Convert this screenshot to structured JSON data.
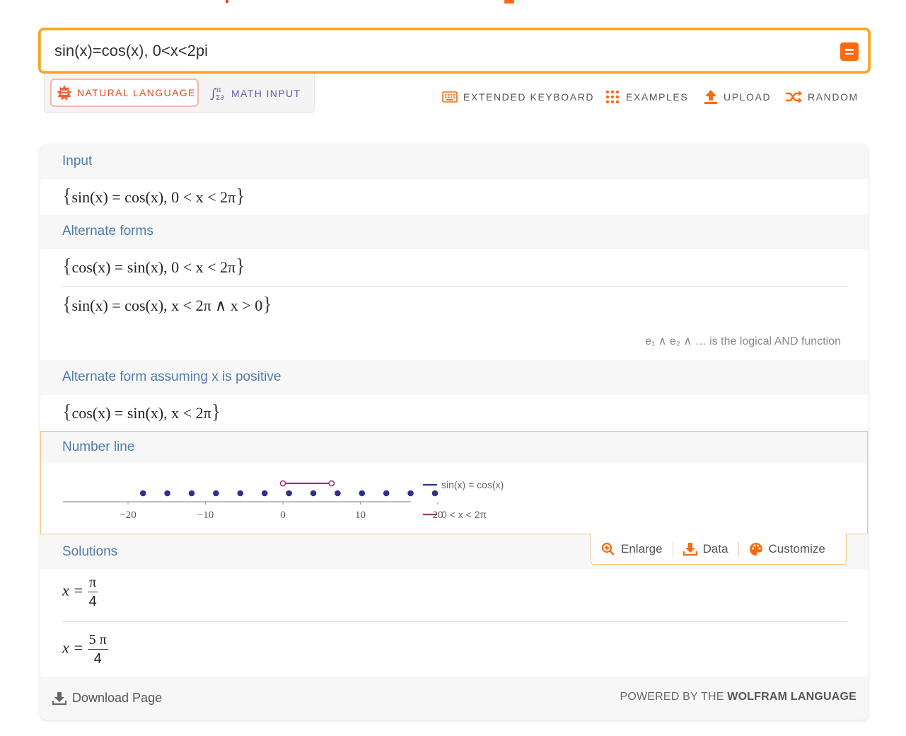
{
  "search": {
    "value": "sin(x)=cos(x), 0<x<2pi"
  },
  "modes": {
    "natural": "NATURAL LANGUAGE",
    "math": "MATH INPUT"
  },
  "toolbar": {
    "keyboard": "EXTENDED KEYBOARD",
    "examples": "EXAMPLES",
    "upload": "UPLOAD",
    "random": "RANDOM"
  },
  "pods": {
    "input": {
      "title": "Input",
      "expr": "sin(x) = cos(x), 0 < x < 2π"
    },
    "alternate_forms": {
      "title": "Alternate forms",
      "items": [
        "cos(x) = sin(x), 0 < x < 2π",
        "sin(x) = cos(x), x < 2π ∧ x > 0"
      ],
      "note": "e₁ ∧ e₂ ∧ … is the logical AND function"
    },
    "alt_positive": {
      "title": "Alternate form assuming x is positive",
      "expr": "cos(x) = sin(x), x < 2π"
    },
    "number_line": {
      "title": "Number line",
      "ticks": [
        "-20",
        "-10",
        "0",
        "10",
        "20"
      ],
      "legend": [
        "sin(x) = cos(x)",
        "0 < x < 2π"
      ],
      "colors": {
        "points": "#2f2f8f",
        "interval": "#a0357a"
      }
    },
    "solutions": {
      "title": "Solutions",
      "items": [
        {
          "lhs": "x =",
          "num": "π",
          "den": "4"
        },
        {
          "lhs": "x =",
          "num": "5 π",
          "den": "4"
        }
      ]
    }
  },
  "actions": {
    "enlarge": "Enlarge",
    "data": "Data",
    "customize": "Customize"
  },
  "footer": {
    "download": "Download Page",
    "powered_prefix": "POWERED BY THE",
    "powered_brand": "WOLFRAM LANGUAGE"
  },
  "chart_data": {
    "type": "scatter",
    "title": "",
    "xlim": [
      -22,
      22
    ],
    "ticks": [
      -20,
      -10,
      0,
      10,
      20
    ],
    "series": [
      {
        "name": "sin(x) = cos(x)",
        "type": "points",
        "x": [
          -18.06,
          -14.92,
          -11.78,
          -8.64,
          -5.5,
          -2.36,
          0.785,
          3.93,
          7.07,
          10.21,
          13.35,
          16.49,
          19.63
        ]
      },
      {
        "name": "0 < x < 2π",
        "type": "interval",
        "from": 0,
        "to": 6.283,
        "open_ends": true
      }
    ]
  }
}
